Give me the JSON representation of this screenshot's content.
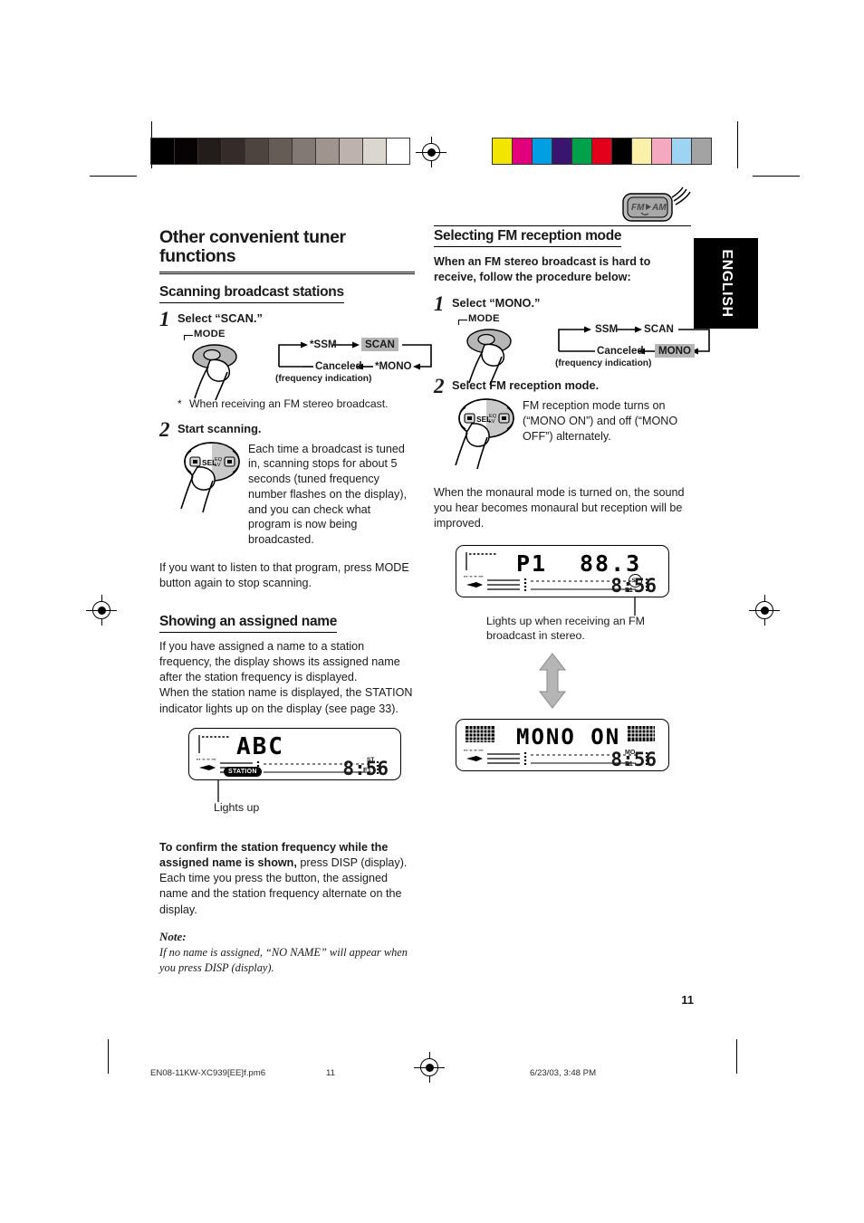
{
  "document": {
    "page_number": "11",
    "language_tab": "ENGLISH",
    "footer": {
      "file_name": "EN08-11KW-XC939[EE]f.pm6",
      "page": "11",
      "timestamp": "6/23/03, 3:48 PM"
    },
    "registration": {
      "grayscale_ramp": [
        "#000000",
        "#070305",
        "#221c1b",
        "#342c29",
        "#4d443f",
        "#655c56",
        "#827874",
        "#a0948f",
        "#bdb2ad",
        "#dcd6d1",
        "#ffffff"
      ],
      "color_swatches": [
        "#f2e500",
        "#e2007d",
        "#009fe3",
        "#3a1570",
        "#00a14b",
        "#e2001a",
        "#000000",
        "#faf0aa",
        "#f4a9c0",
        "#9dd4f2",
        "#a3a3a3"
      ]
    }
  },
  "left_column": {
    "title": "Other convenient tuner functions",
    "section1": {
      "heading": "Scanning broadcast stations",
      "step1": {
        "number": "1",
        "head": "Select “SCAN.”",
        "button_label": "MODE",
        "flow": {
          "item1": "*SSM",
          "item2": "SCAN",
          "item3": "*MONO",
          "item4": "Canceled",
          "note": "(frequency indication)",
          "highlighted": "SCAN"
        },
        "footnote_marker": "*",
        "footnote": "When receiving an FM stereo broadcast."
      },
      "step2": {
        "number": "2",
        "head": "Start scanning.",
        "body": "Each time a broadcast is tuned in, scanning stops for about 5 seconds (tuned frequency number flashes on the display), and you can check what program is now being broadcasted.",
        "knob_label": "SEL",
        "knob_sub1": "EQ",
        "knob_sub2": "LV"
      },
      "closing": "If you want to listen to that program, press MODE button again to stop scanning."
    },
    "section2": {
      "heading": "Showing an assigned name",
      "intro": "If you have assigned a name to a station frequency, the display shows its assigned name after the station frequency is displayed.\nWhen the station name is displayed, the STATION indicator lights up on the display (see page 33).",
      "display": {
        "main_text": "ABC",
        "station_indicator": "STATION",
        "clock": "8:56",
        "f1_tag": "F1",
        "st_tag": "ST"
      },
      "callout": "Lights up",
      "confirm_bold": "To confirm the station frequency while the assigned name is shown,",
      "confirm_rest": " press DISP (display). Each time you press the button, the assigned name and the station frequency alternate on the display.",
      "note_heading": "Note:",
      "note_body": "If no name is assigned, “NO NAME” will appear when you press DISP (display)."
    }
  },
  "right_column": {
    "fm_am_icon_label": "FM AM",
    "heading": "Selecting FM reception mode",
    "intro": "When an FM stereo broadcast is hard to receive, follow the procedure below:",
    "step1": {
      "number": "1",
      "head": "Select “MONO.”",
      "button_label": "MODE",
      "flow": {
        "item1": "SSM",
        "item2": "SCAN",
        "item3": "MONO",
        "item4": "Canceled",
        "note": "(frequency indication)",
        "highlighted": "MONO"
      }
    },
    "step2": {
      "number": "2",
      "head": "Select FM reception mode.",
      "body": "FM reception mode turns on (“MONO ON”) and off (“MONO OFF”) alternately.",
      "knob_label": "SEL",
      "knob_sub1": "EQ",
      "knob_sub2": "LV"
    },
    "monaural_note": "When the monaural mode is turned on, the sound you hear becomes monaural but reception will be improved.",
    "display1": {
      "preset": "P1",
      "frequency": "88.3",
      "clock": "8:56",
      "f1_tag": "F1",
      "st_tag": "ST"
    },
    "display1_caption": "Lights up when receiving an FM broadcast in stereo.",
    "display2": {
      "main_text": "MONO ON",
      "clock": "8:56",
      "f1_tag": "F1",
      "mo_tag": "MO"
    }
  }
}
